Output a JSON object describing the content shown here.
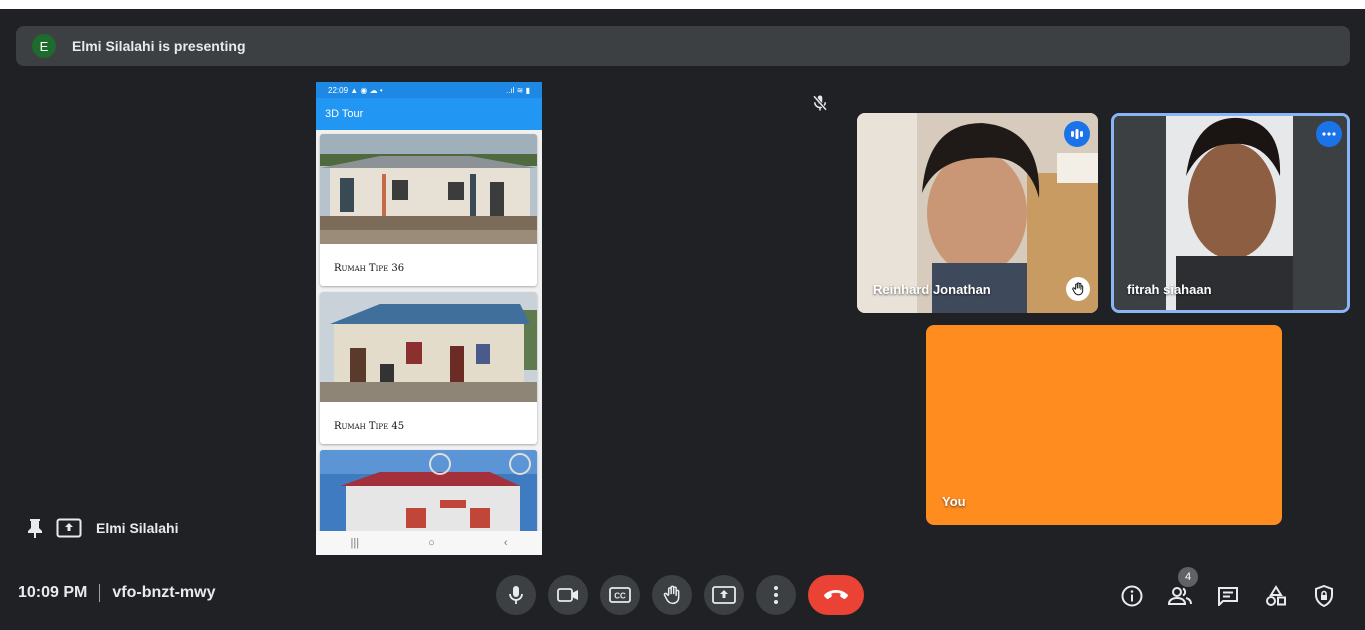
{
  "banner": {
    "avatar_letter": "E",
    "text": "Elmi Silalahi is presenting"
  },
  "phone": {
    "status_time": "22:09",
    "status_icons": "▲ ◉ ☁ •",
    "status_right": "..ıl ≋ ▮",
    "app_title": "3D Tour",
    "cards": [
      {
        "caption": "Rumah Tipe 36"
      },
      {
        "caption": "Rumah Tipe 45"
      },
      {
        "caption": ""
      }
    ],
    "nav": [
      "|||",
      "○",
      "‹"
    ]
  },
  "participants": [
    {
      "name": "Reinhard Jonathan",
      "badge": "speaking-icon",
      "corner": "raised-hand-icon"
    },
    {
      "name": "fitrah siahaan",
      "badge": "more-options-icon"
    },
    {
      "name": "You"
    }
  ],
  "presenter_label": {
    "name": "Elmi Silalahi"
  },
  "meeting": {
    "time": "10:09 PM",
    "code": "vfo-bnzt-mwy"
  },
  "people_count": "4",
  "colors": {
    "background": "#202124",
    "surface": "#3c4043",
    "accent_blue": "#8ab4f8",
    "end_call": "#ea4335",
    "you_tile": "#ff8c1f"
  }
}
